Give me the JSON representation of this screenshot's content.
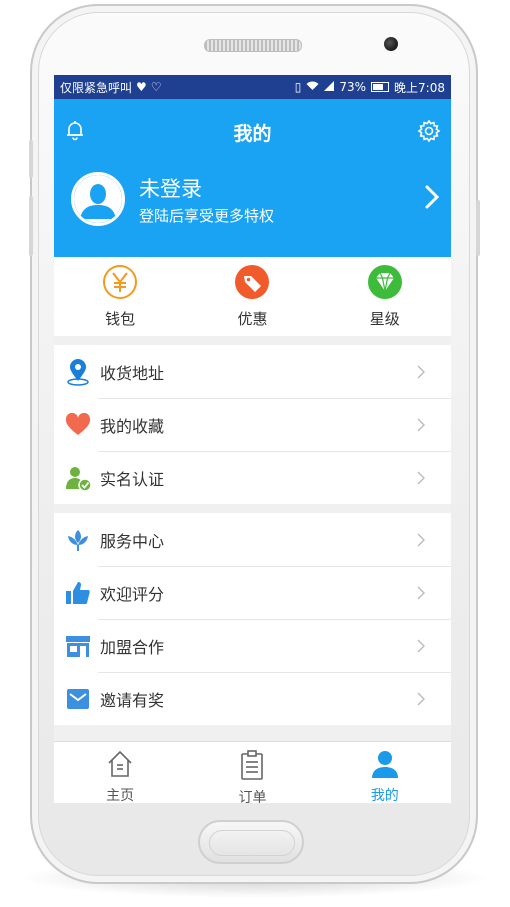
{
  "status_bar": {
    "left_text": "仅限紧急呼叫",
    "battery": "73%",
    "time": "晚上7:08"
  },
  "header": {
    "title": "我的",
    "login_title": "未登录",
    "login_subtitle": "登陆后享受更多特权"
  },
  "quick_actions": [
    {
      "label": "钱包",
      "icon": "yuan-icon",
      "color": "#f39a1e"
    },
    {
      "label": "优惠",
      "icon": "tag-icon",
      "color": "#f15a2b"
    },
    {
      "label": "星级",
      "icon": "diamond-icon",
      "color": "#3dbb3a"
    }
  ],
  "menu_group1": [
    {
      "label": "收货地址",
      "icon": "location-pin-icon"
    },
    {
      "label": "我的收藏",
      "icon": "heart-icon"
    },
    {
      "label": "实名认证",
      "icon": "verified-user-icon"
    }
  ],
  "menu_group2": [
    {
      "label": "服务中心",
      "icon": "flower-icon"
    },
    {
      "label": "欢迎评分",
      "icon": "thumbs-up-icon"
    },
    {
      "label": "加盟合作",
      "icon": "store-icon"
    },
    {
      "label": "邀请有奖",
      "icon": "envelope-icon"
    }
  ],
  "tabbar": [
    {
      "label": "主页",
      "icon": "home-icon",
      "active": false
    },
    {
      "label": "订单",
      "icon": "clipboard-icon",
      "active": false
    },
    {
      "label": "我的",
      "icon": "person-icon",
      "active": true
    }
  ],
  "colors": {
    "status_bar": "#1f3f91",
    "header": "#1aa3f2",
    "accent": "#1a9ae8"
  }
}
